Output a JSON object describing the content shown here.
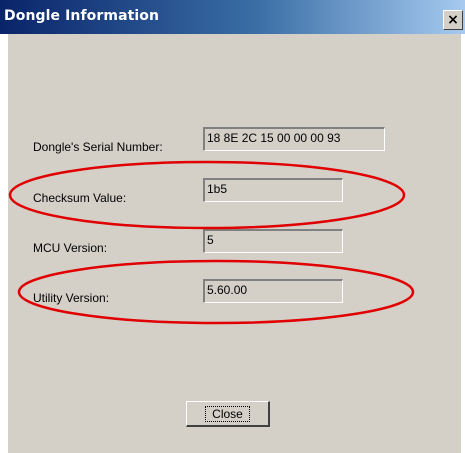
{
  "window": {
    "title": "Dongle Information",
    "close_glyph": "×"
  },
  "fields": [
    {
      "label": "Dongle's Serial Number:",
      "value": "18 8E 2C 15 00 00 00 93"
    },
    {
      "label": "Checksum Value:",
      "value": "1b5"
    },
    {
      "label": "MCU Version:",
      "value": "5"
    },
    {
      "label": "Utility Version:",
      "value": "5.60.00"
    }
  ],
  "buttons": {
    "close_label": "Close"
  },
  "annotations": {
    "highlight_color": "#e00000"
  }
}
